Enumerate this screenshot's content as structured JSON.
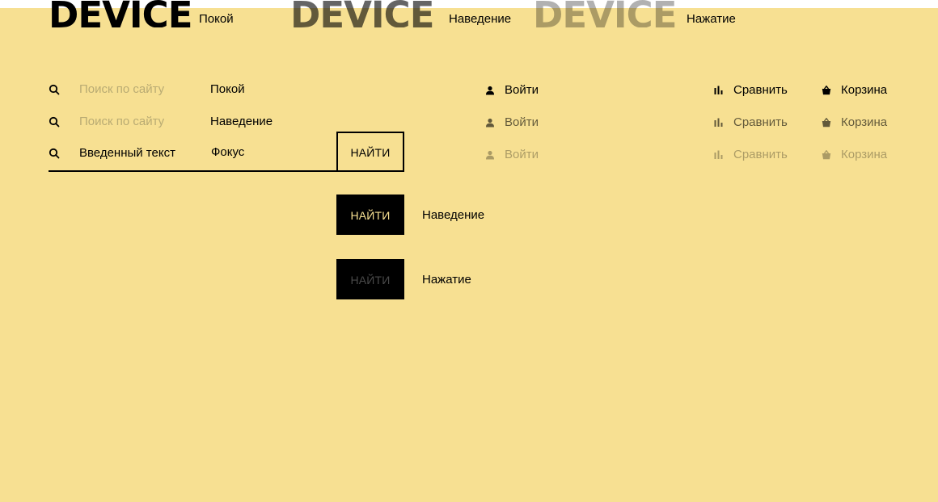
{
  "logo": {
    "text": "DEVICE",
    "states": {
      "rest": "Покой",
      "hover": "Наведение",
      "active": "Нажатие"
    }
  },
  "search": {
    "placeholder": "Поиск по сайту",
    "typed_value": "Введенный текст",
    "states": {
      "rest": "Покой",
      "hover": "Наведение",
      "focus": "Фокус"
    }
  },
  "button": {
    "label": "НАЙТИ",
    "states": {
      "hover": "Наведение",
      "active": "Нажатие"
    }
  },
  "user_nav": {
    "login": "Войти",
    "compare": "Сравнить",
    "cart": "Корзина"
  },
  "colors": {
    "background": "#f7e092",
    "text": "#000000",
    "placeholder": "#b9ab73",
    "top_bar": "#ffffff"
  },
  "icons": [
    "search-icon",
    "user-icon",
    "compare-icon",
    "basket-icon"
  ]
}
